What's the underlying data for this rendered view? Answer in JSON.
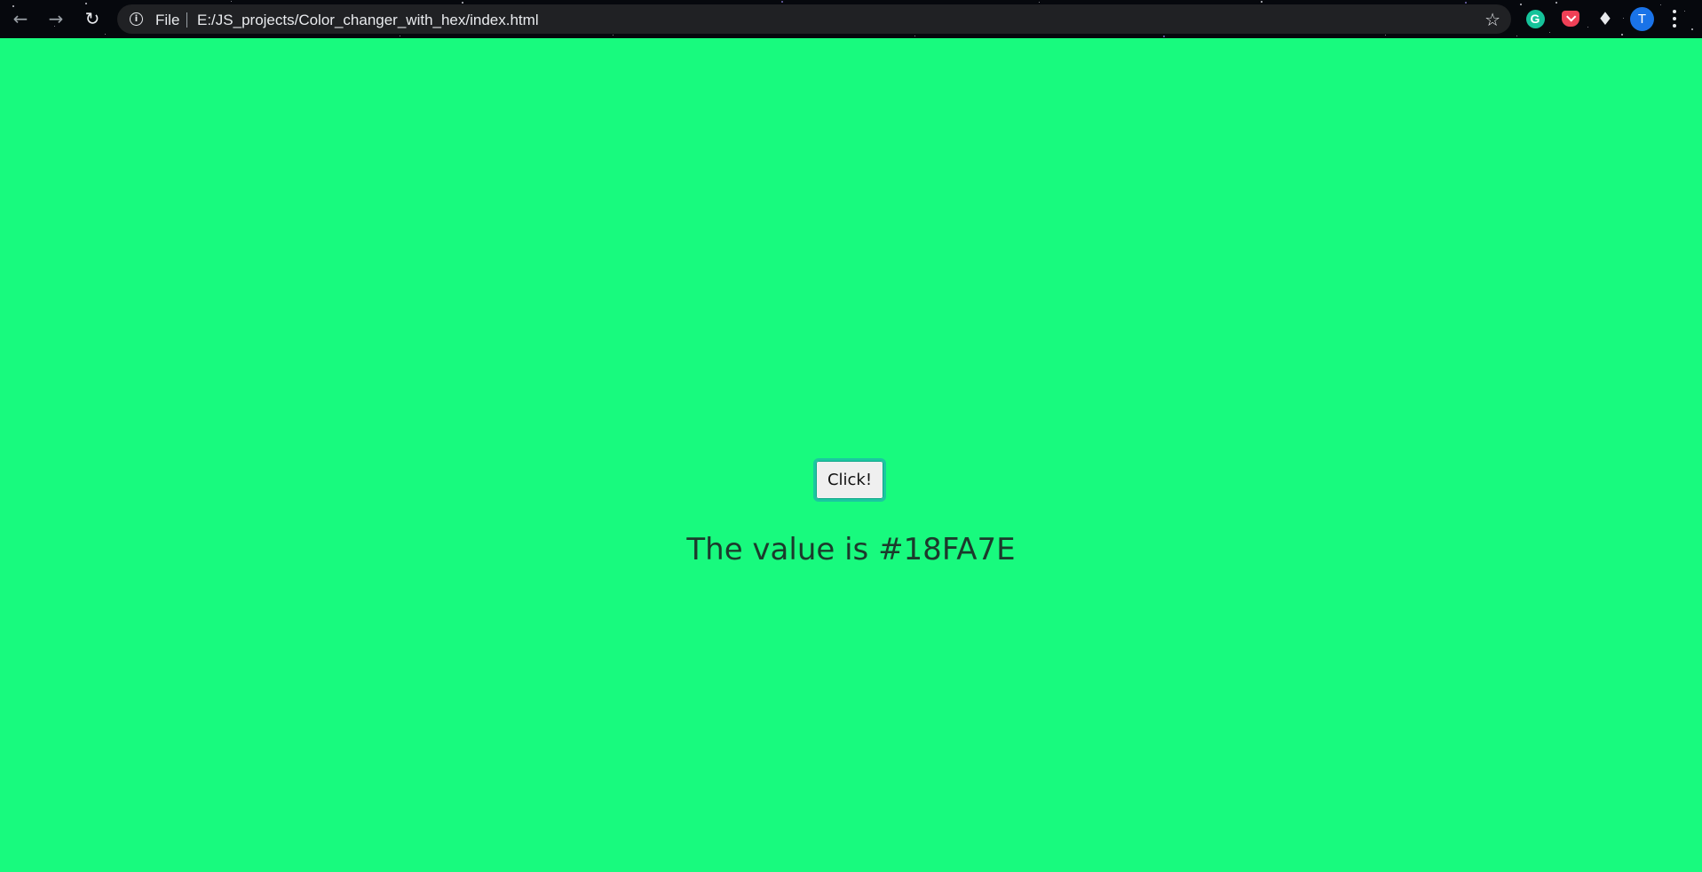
{
  "browser": {
    "scheme_label": "File",
    "url": "E:/JS_projects/Color_changer_with_hex/index.html",
    "profile_initial": "T",
    "extensions": [
      "grammarly-icon",
      "pocket-icon",
      "extensions-puzzle-icon"
    ]
  },
  "page": {
    "background_color": "#18FA7E",
    "button_label": "Click!",
    "value_text": "The value is #18FA7E"
  }
}
